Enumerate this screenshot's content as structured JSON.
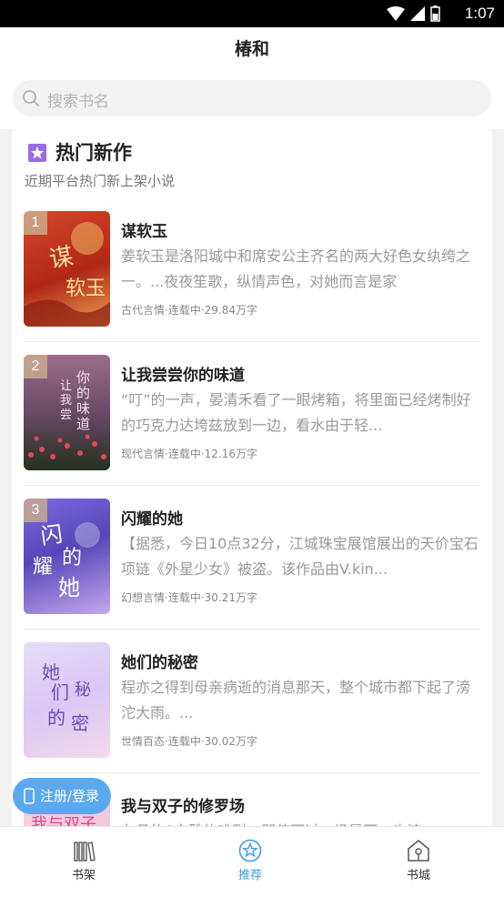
{
  "status_bar": {
    "time": "1:07"
  },
  "app": {
    "title": "椿和"
  },
  "search": {
    "placeholder": "搜索书名"
  },
  "section": {
    "title": "热门新作",
    "subtitle": "近期平台热门新上架小说"
  },
  "books": [
    {
      "rank": "1",
      "title": "谋软玉",
      "desc": "姜软玉是洛阳城中和席安公主齐名的两大好色女纨绔之一。...夜夜笙歌，纵情声色，对她而言是家",
      "meta": "古代言情·连载中·29.84万字",
      "cover_colors": [
        "#c2341e",
        "#e8b262"
      ]
    },
    {
      "rank": "2",
      "title": "让我尝尝你的味道",
      "desc": "“叮”的一声，晏清禾看了一眼烤箱，将里面已经烤制好的巧克力达垮兹放到一边，看水由于轻...",
      "meta": "现代言情·连载中·12.16万字",
      "cover_colors": [
        "#8a5a7a",
        "#2d3b2a"
      ]
    },
    {
      "rank": "3",
      "title": "闪耀的她",
      "desc": "【据悉，今日10点32分，江城珠宝展馆展出的天价宝石项链《外星少女》被盗。该作品由V.kin...",
      "meta": "幻想言情·连载中·30.21万字",
      "cover_colors": [
        "#6a5acd",
        "#b8a4e8"
      ]
    },
    {
      "rank": "",
      "title": "她们的秘密",
      "desc": "程亦之得到母亲病逝的消息那天，整个城市都下起了滂沱大雨。...",
      "meta": "世情百态·连载中·30.02万字",
      "cover_colors": [
        "#d8c8f4",
        "#f4d8ea"
      ]
    },
    {
      "rank": "",
      "title": "我与双子的修罗场",
      "desc": "九月的S市酷热难耐，即使下过一场暴雨，也该",
      "meta": "",
      "cover_colors": [
        "#f4c2d8",
        "#fff"
      ]
    }
  ],
  "login_button": {
    "label": "注册/登录"
  },
  "tabs": [
    {
      "label": "书架",
      "icon": "bookshelf-icon"
    },
    {
      "label": "推荐",
      "icon": "recommend-icon"
    },
    {
      "label": "书城",
      "icon": "bookstore-icon"
    }
  ],
  "colors": {
    "accent": "#3d9be9",
    "login_bg": "#5aa9ee",
    "section_icon": "#9b6be8"
  }
}
